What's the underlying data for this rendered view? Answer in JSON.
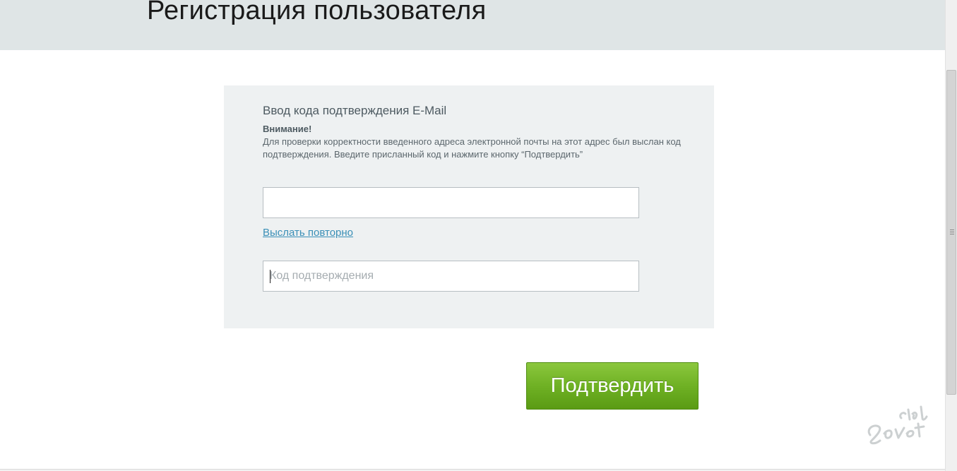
{
  "header": {
    "title": "Регистрация пользователя"
  },
  "panel": {
    "heading": "Ввод кода подтверждения E-Mail",
    "warning_label": "Внимание!",
    "warning_text": "Для проверки корректности введенного адреса электронной почты на этот адрес был выслан код подтверждения. Введите присланный код и нажмите кнопку “Подтвердить”",
    "email_field": {
      "value": "",
      "placeholder": ""
    },
    "resend_link": "Выслать повторно",
    "code_field": {
      "value": "",
      "placeholder": "Код подтверждения"
    }
  },
  "confirm_button": {
    "label": "Подтвердить"
  },
  "watermark": {
    "text": "club Sovet"
  },
  "colors": {
    "header_bg": "#dfe5e6",
    "panel_bg": "#eef1f2",
    "link": "#3a8fb7",
    "button_green": "#6fb124"
  },
  "icons": {
    "scrollbar_grip": "grip-icon",
    "watermark_logo": "watermark-logo"
  }
}
